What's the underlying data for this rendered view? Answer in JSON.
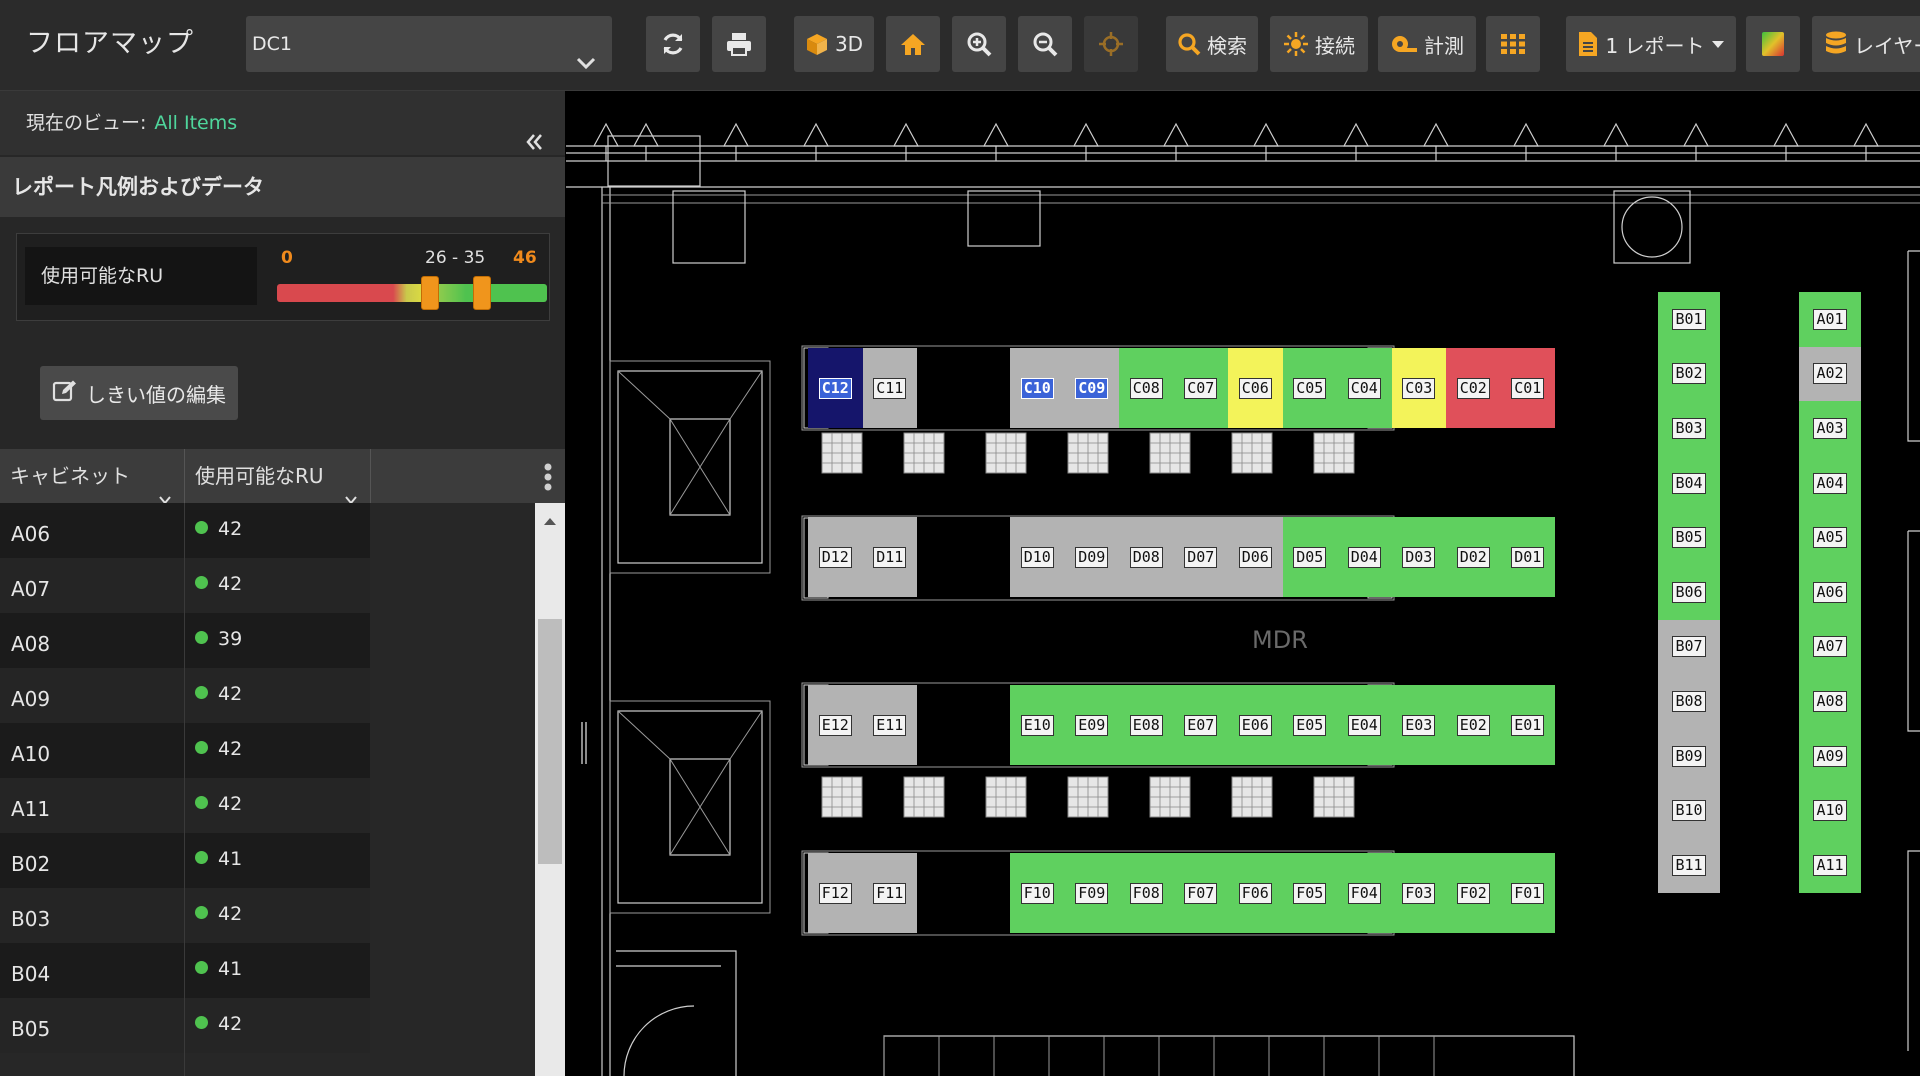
{
  "toolbar": {
    "app_title": "フロアマップ",
    "datacenter_selected": "DC1",
    "btn_3d": "3D",
    "btn_search": "検索",
    "btn_connect": "接続",
    "btn_measure": "計測",
    "btn_report": "1 レポート",
    "btn_layer": "レイヤー"
  },
  "panel": {
    "current_view_label": "現在のビュー:",
    "current_view_value": "All Items",
    "legend_title": "レポート凡例およびデータ",
    "legend": {
      "metric": "使用可能なRU",
      "min": "0",
      "mid": "26 - 35",
      "max": "46",
      "low_handle": 26,
      "high_handle": 35,
      "scale_max": 46
    },
    "edit_threshold_label": "しきい値の編集",
    "table": {
      "col_cabinet": "キャビネット",
      "col_available_ru": "使用可能なRU",
      "rows": [
        {
          "cabinet": "A06",
          "ru": "42"
        },
        {
          "cabinet": "A07",
          "ru": "42"
        },
        {
          "cabinet": "A08",
          "ru": "39"
        },
        {
          "cabinet": "A09",
          "ru": "42"
        },
        {
          "cabinet": "A10",
          "ru": "42"
        },
        {
          "cabinet": "A11",
          "ru": "42"
        },
        {
          "cabinet": "B02",
          "ru": "41"
        },
        {
          "cabinet": "B03",
          "ru": "42"
        },
        {
          "cabinet": "B04",
          "ru": "41"
        },
        {
          "cabinet": "B05",
          "ru": "42"
        }
      ]
    }
  },
  "map": {
    "room_label": "MDR",
    "colors": {
      "green": "#5fd05f",
      "gray": "#b3b3b3",
      "yellow": "#f3f35a",
      "red": "#e0505a",
      "navy": "#15156b"
    },
    "rows": {
      "C_left": [
        {
          "id": "C12",
          "status": "navy",
          "selected": true
        },
        {
          "id": "C11",
          "status": "gray"
        }
      ],
      "C_main": [
        {
          "id": "C10",
          "status": "gray",
          "selected": true
        },
        {
          "id": "C09",
          "status": "gray",
          "selected": true
        },
        {
          "id": "C08",
          "status": "green"
        },
        {
          "id": "C07",
          "status": "green"
        },
        {
          "id": "C06",
          "status": "yellow"
        },
        {
          "id": "C05",
          "status": "green"
        },
        {
          "id": "C04",
          "status": "green"
        },
        {
          "id": "C03",
          "status": "yellow"
        },
        {
          "id": "C02",
          "status": "red"
        },
        {
          "id": "C01",
          "status": "red"
        }
      ],
      "D_left": [
        {
          "id": "D12",
          "status": "gray"
        },
        {
          "id": "D11",
          "status": "gray"
        }
      ],
      "D_main": [
        {
          "id": "D10",
          "status": "gray"
        },
        {
          "id": "D09",
          "status": "gray"
        },
        {
          "id": "D08",
          "status": "gray"
        },
        {
          "id": "D07",
          "status": "gray"
        },
        {
          "id": "D06",
          "status": "gray"
        },
        {
          "id": "D05",
          "status": "green"
        },
        {
          "id": "D04",
          "status": "green"
        },
        {
          "id": "D03",
          "status": "green"
        },
        {
          "id": "D02",
          "status": "green"
        },
        {
          "id": "D01",
          "status": "green"
        }
      ],
      "E_left": [
        {
          "id": "E12",
          "status": "gray"
        },
        {
          "id": "E11",
          "status": "gray"
        }
      ],
      "E_main": [
        {
          "id": "E10",
          "status": "green"
        },
        {
          "id": "E09",
          "status": "green"
        },
        {
          "id": "E08",
          "status": "green"
        },
        {
          "id": "E07",
          "status": "green"
        },
        {
          "id": "E06",
          "status": "green"
        },
        {
          "id": "E05",
          "status": "green"
        },
        {
          "id": "E04",
          "status": "green"
        },
        {
          "id": "E03",
          "status": "green"
        },
        {
          "id": "E02",
          "status": "green"
        },
        {
          "id": "E01",
          "status": "green"
        }
      ],
      "F_left": [
        {
          "id": "F12",
          "status": "gray"
        },
        {
          "id": "F11",
          "status": "gray"
        }
      ],
      "F_main": [
        {
          "id": "F10",
          "status": "green"
        },
        {
          "id": "F09",
          "status": "green"
        },
        {
          "id": "F08",
          "status": "green"
        },
        {
          "id": "F07",
          "status": "green"
        },
        {
          "id": "F06",
          "status": "green"
        },
        {
          "id": "F05",
          "status": "green"
        },
        {
          "id": "F04",
          "status": "green"
        },
        {
          "id": "F03",
          "status": "green"
        },
        {
          "id": "F02",
          "status": "green"
        },
        {
          "id": "F01",
          "status": "green"
        }
      ],
      "B_col": [
        {
          "id": "B01",
          "status": "green"
        },
        {
          "id": "B02",
          "status": "green"
        },
        {
          "id": "B03",
          "status": "green"
        },
        {
          "id": "B04",
          "status": "green"
        },
        {
          "id": "B05",
          "status": "green"
        },
        {
          "id": "B06",
          "status": "green"
        },
        {
          "id": "B07",
          "status": "gray"
        },
        {
          "id": "B08",
          "status": "gray"
        },
        {
          "id": "B09",
          "status": "gray"
        },
        {
          "id": "B10",
          "status": "gray"
        },
        {
          "id": "B11",
          "status": "gray"
        }
      ],
      "A_col": [
        {
          "id": "A01",
          "status": "green"
        },
        {
          "id": "A02",
          "status": "gray"
        },
        {
          "id": "A03",
          "status": "green"
        },
        {
          "id": "A04",
          "status": "green"
        },
        {
          "id": "A05",
          "status": "green"
        },
        {
          "id": "A06",
          "status": "green"
        },
        {
          "id": "A07",
          "status": "green"
        },
        {
          "id": "A08",
          "status": "green"
        },
        {
          "id": "A09",
          "status": "green"
        },
        {
          "id": "A10",
          "status": "green"
        },
        {
          "id": "A11",
          "status": "green"
        }
      ]
    }
  }
}
